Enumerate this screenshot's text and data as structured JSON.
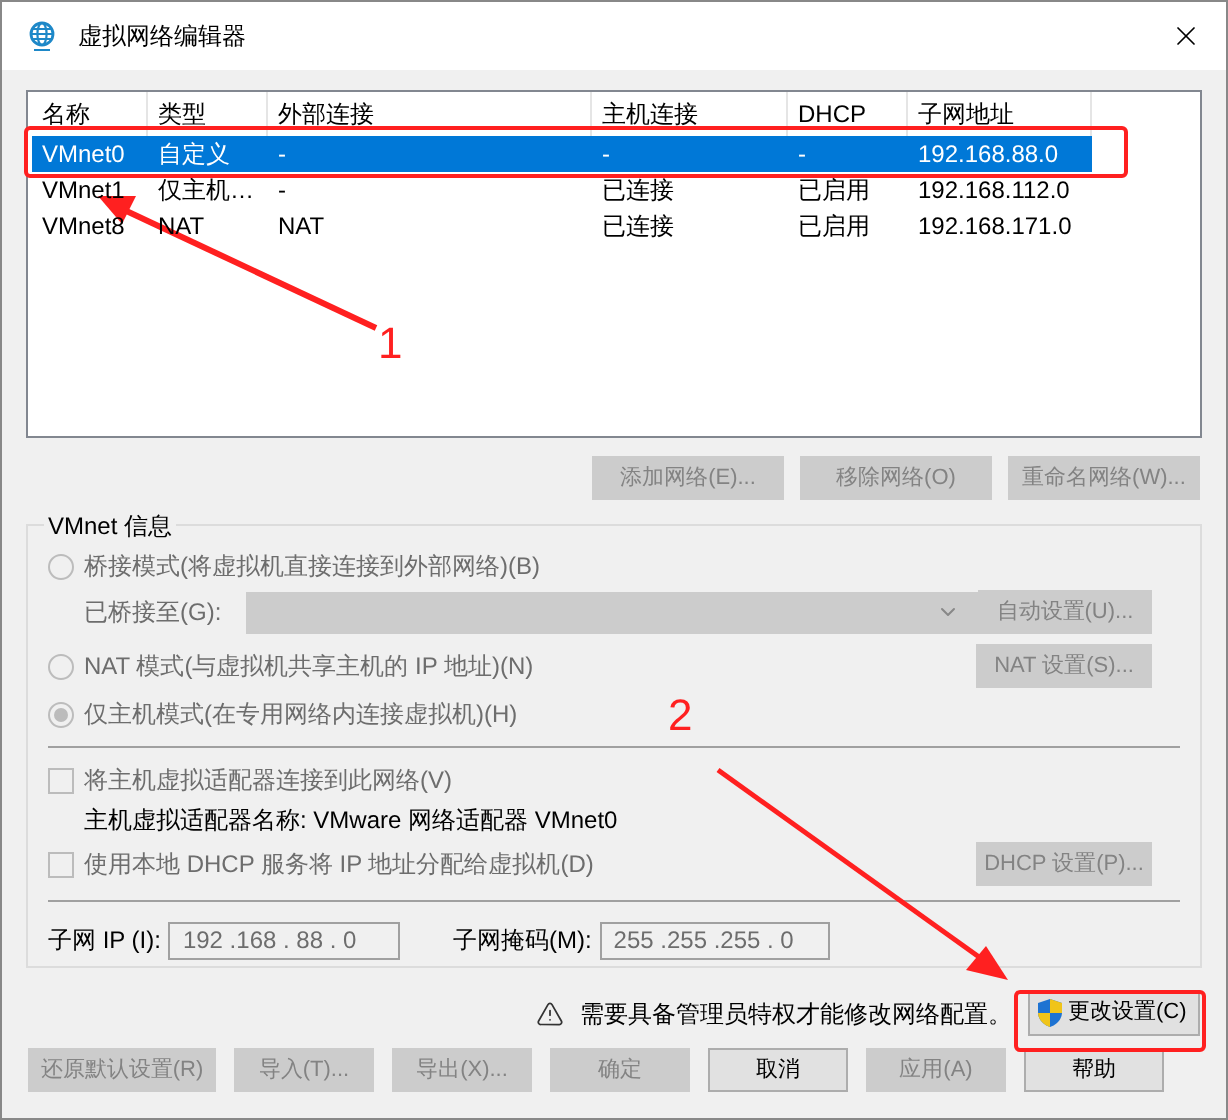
{
  "window": {
    "title": "虚拟网络编辑器"
  },
  "table": {
    "columns": [
      "名称",
      "类型",
      "外部连接",
      "主机连接",
      "DHCP",
      "子网地址"
    ],
    "rows": [
      {
        "cells": [
          "VMnet0",
          "自定义",
          "-",
          "-",
          "-",
          "192.168.88.0"
        ],
        "selected": true
      },
      {
        "cells": [
          "VMnet1",
          "仅主机…",
          "-",
          "已连接",
          "已启用",
          "192.168.112.0"
        ],
        "selected": false
      },
      {
        "cells": [
          "VMnet8",
          "NAT",
          "NAT",
          "已连接",
          "已启用",
          "192.168.171.0"
        ],
        "selected": false
      }
    ]
  },
  "list_buttons": [
    {
      "label": "添加网络(E)...",
      "disabled": true
    },
    {
      "label": "移除网络(O)",
      "disabled": true
    },
    {
      "label": "重命名网络(W)...",
      "disabled": true
    }
  ],
  "info": {
    "legend": "VMnet 信息",
    "disabled": true,
    "bridged": {
      "label": "桥接模式(将虚拟机直接连接到外部网络)(B)",
      "selected": false
    },
    "bridge_to": {
      "label": "已桥接至(G):"
    },
    "auto_settings": {
      "label": "自动设置(U)...",
      "disabled": true
    },
    "nat": {
      "label": "NAT 模式(与虚拟机共享主机的 IP 地址)(N)",
      "selected": false
    },
    "nat_settings": {
      "label": "NAT 设置(S)...",
      "disabled": true
    },
    "host_only": {
      "label": "仅主机模式(在专用网络内连接虚拟机)(H)",
      "selected": true
    },
    "connect_adapter": {
      "label": "将主机虚拟适配器连接到此网络(V)",
      "checked": false
    },
    "adapter_name": "主机虚拟适配器名称: VMware 网络适配器 VMnet0",
    "dhcp": {
      "label": "使用本地 DHCP 服务将 IP 地址分配给虚拟机(D)",
      "checked": false
    },
    "dhcp_settings": {
      "label": "DHCP 设置(P)...",
      "disabled": true
    },
    "subnet_ip": {
      "label": "子网 IP (I):",
      "value": "192 .168 . 88 . 0"
    },
    "subnet_mask": {
      "label": "子网掩码(M):",
      "value": "255 .255 .255 . 0"
    }
  },
  "warning": "需要具备管理员特权才能修改网络配置。",
  "change_button": {
    "label": "更改设置(C)"
  },
  "footer_buttons": [
    {
      "label": "还原默认设置(R)",
      "disabled": true
    },
    {
      "label": "导入(T)...",
      "disabled": true
    },
    {
      "label": "导出(X)...",
      "disabled": true
    },
    {
      "label": "确定",
      "disabled": true
    },
    {
      "label": "取消",
      "disabled": false
    },
    {
      "label": "应用(A)",
      "disabled": true
    },
    {
      "label": "帮助",
      "disabled": false
    }
  ],
  "annotations": [
    {
      "label": "1"
    },
    {
      "label": "2"
    }
  ]
}
